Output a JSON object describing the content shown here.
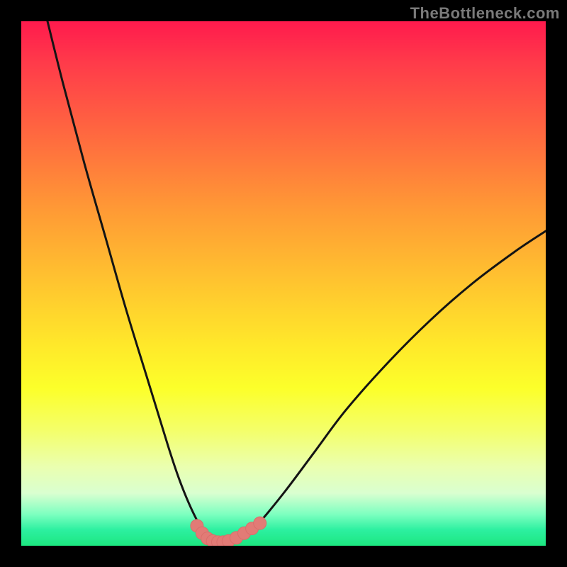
{
  "watermark": "TheBottleneck.com",
  "colors": {
    "frame": "#000000",
    "curve_stroke": "#141414",
    "marker_fill": "#e27b76",
    "marker_stroke": "#d96e6a",
    "gradient_top": "#ff1a4d",
    "gradient_bottom": "#1de780"
  },
  "chart_data": {
    "type": "line",
    "title": "",
    "xlabel": "",
    "ylabel": "",
    "xlim": [
      0,
      100
    ],
    "ylim": [
      0,
      100
    ],
    "annotations": [],
    "series": [
      {
        "name": "bottleneck_curve",
        "x": [
          5,
          8,
          12,
          16,
          20,
          24,
          28,
          30,
          32,
          34,
          36,
          38,
          40,
          42,
          45,
          50,
          56,
          62,
          70,
          78,
          86,
          94,
          100
        ],
        "y": [
          100,
          88,
          73,
          59,
          45,
          32,
          19,
          13,
          8,
          4,
          1.5,
          0.5,
          0.5,
          1.5,
          4,
          10,
          18,
          26,
          35,
          43,
          50,
          56,
          60
        ]
      }
    ],
    "markers": {
      "name": "sweet_spot_points",
      "x": [
        33.5,
        34.5,
        35.5,
        36.5,
        37.5,
        38.5,
        39.5,
        41,
        42.5,
        44,
        45.5
      ],
      "y": [
        3.8,
        2.4,
        1.4,
        0.9,
        0.7,
        0.7,
        0.9,
        1.5,
        2.4,
        3.3,
        4.3
      ]
    }
  }
}
